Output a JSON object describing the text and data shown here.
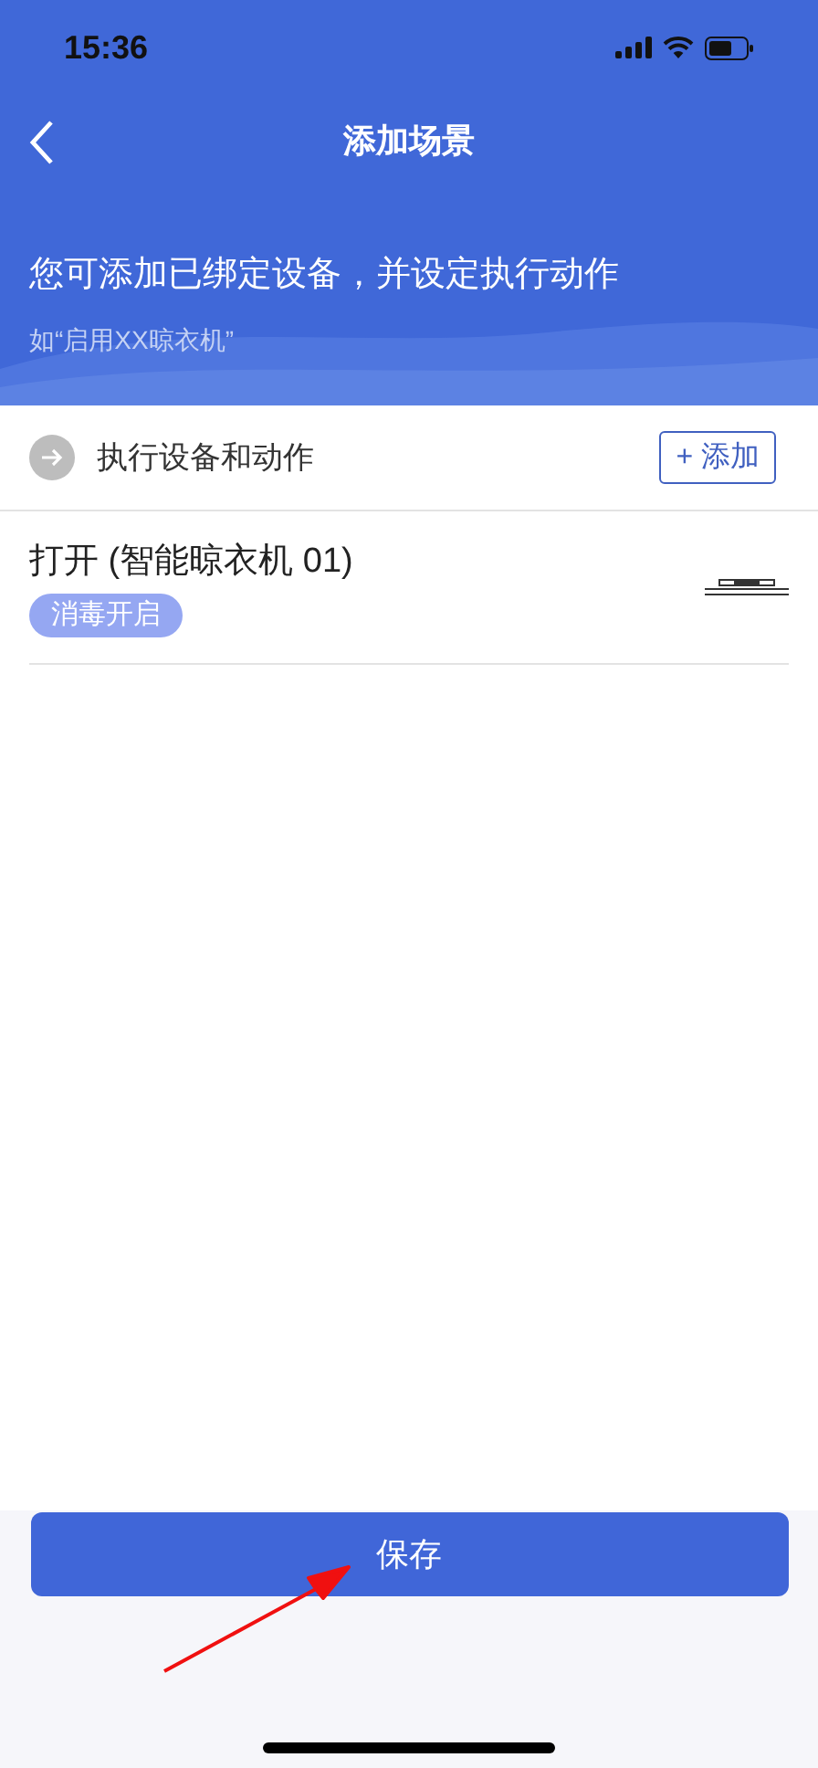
{
  "status_bar": {
    "time": "15:36"
  },
  "nav": {
    "title": "添加场景"
  },
  "intro": {
    "text": "您可添加已绑定设备，并设定执行动作",
    "hint": "如“启用XX晾衣机”"
  },
  "section": {
    "title": "执行设备和动作",
    "add_button": "+ 添加"
  },
  "actions": [
    {
      "title": "打开 (智能晾衣机 01)",
      "tag": "消毒开启"
    }
  ],
  "save_button": "保存"
}
